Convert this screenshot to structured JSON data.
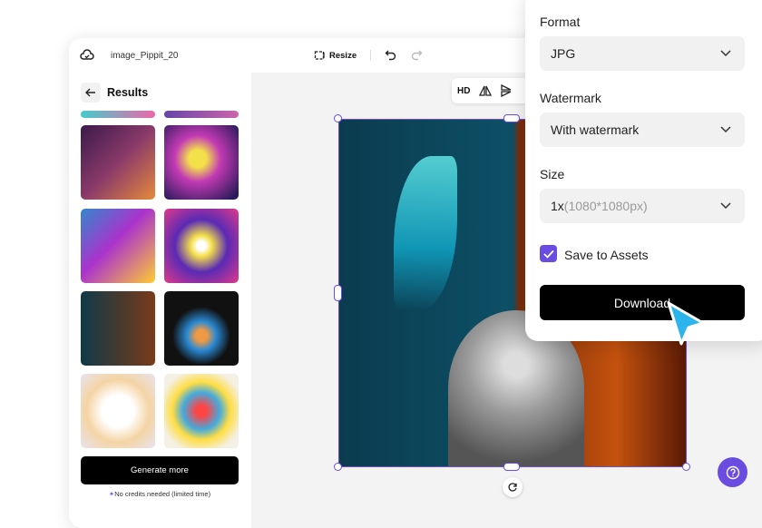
{
  "header": {
    "project_name": "image_Pippit_20",
    "resize_label": "Resize"
  },
  "sidebar": {
    "title": "Results",
    "generate_label": "Generate more",
    "credits_note": "No credits needed (limited time)"
  },
  "canvas_toolbar": {
    "hd_label": "HD"
  },
  "export_panel": {
    "format_label": "Format",
    "format_value": "JPG",
    "watermark_label": "Watermark",
    "watermark_value": "With watermark",
    "size_label": "Size",
    "size_value": "1x",
    "size_detail": "(1080*1080px)",
    "save_assets_label": "Save to Assets",
    "save_assets_checked": true,
    "download_label": "Download"
  },
  "colors": {
    "accent": "#6a4de0",
    "button": "#000000"
  }
}
